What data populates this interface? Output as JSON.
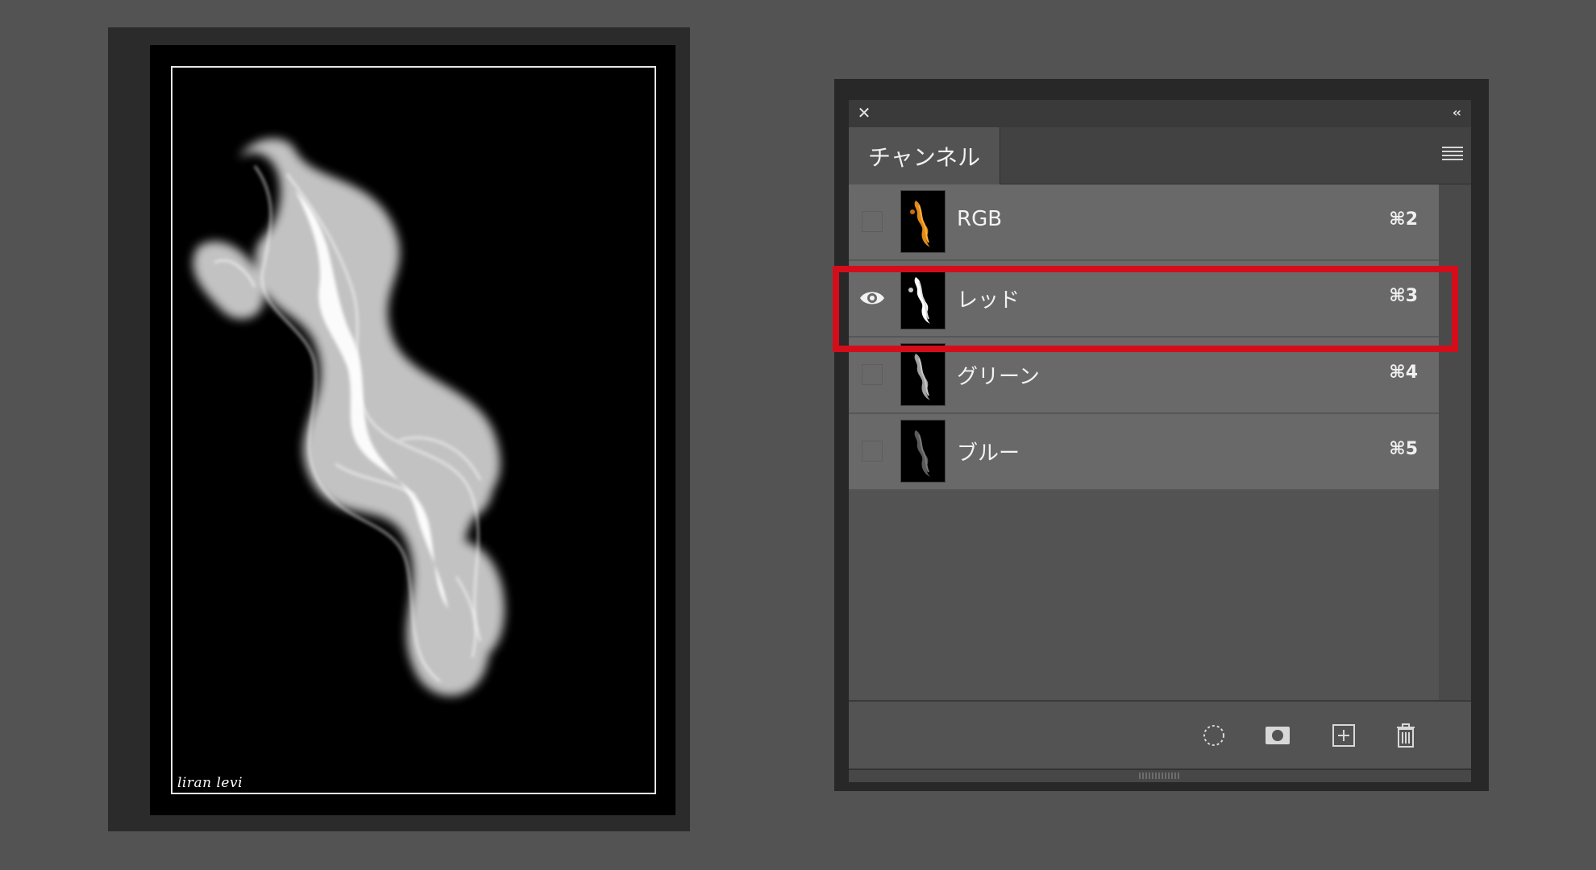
{
  "document": {
    "signature": "liran levi"
  },
  "panel": {
    "tab_label": "チャンネル",
    "icons": {
      "close": "close-icon",
      "collapse": "double-chevron-left-icon",
      "menu": "hamburger-menu-icon"
    },
    "channels": [
      {
        "name": "RGB",
        "shortcut": "⌘2",
        "visible": false,
        "thumb": "color-flame"
      },
      {
        "name": "レッド",
        "shortcut": "⌘3",
        "visible": true,
        "thumb": "white-flame",
        "highlighted": true
      },
      {
        "name": "グリーン",
        "shortcut": "⌘4",
        "visible": false,
        "thumb": "gray-flame"
      },
      {
        "name": "ブルー",
        "shortcut": "⌘5",
        "visible": false,
        "thumb": "dark-flame"
      }
    ],
    "footer_buttons": [
      "load-channel-as-selection-icon",
      "save-selection-as-channel-icon",
      "new-channel-icon",
      "delete-channel-icon"
    ]
  },
  "colors": {
    "highlight": "#d50d1b",
    "workspace": "#535353",
    "row": "#696969"
  }
}
